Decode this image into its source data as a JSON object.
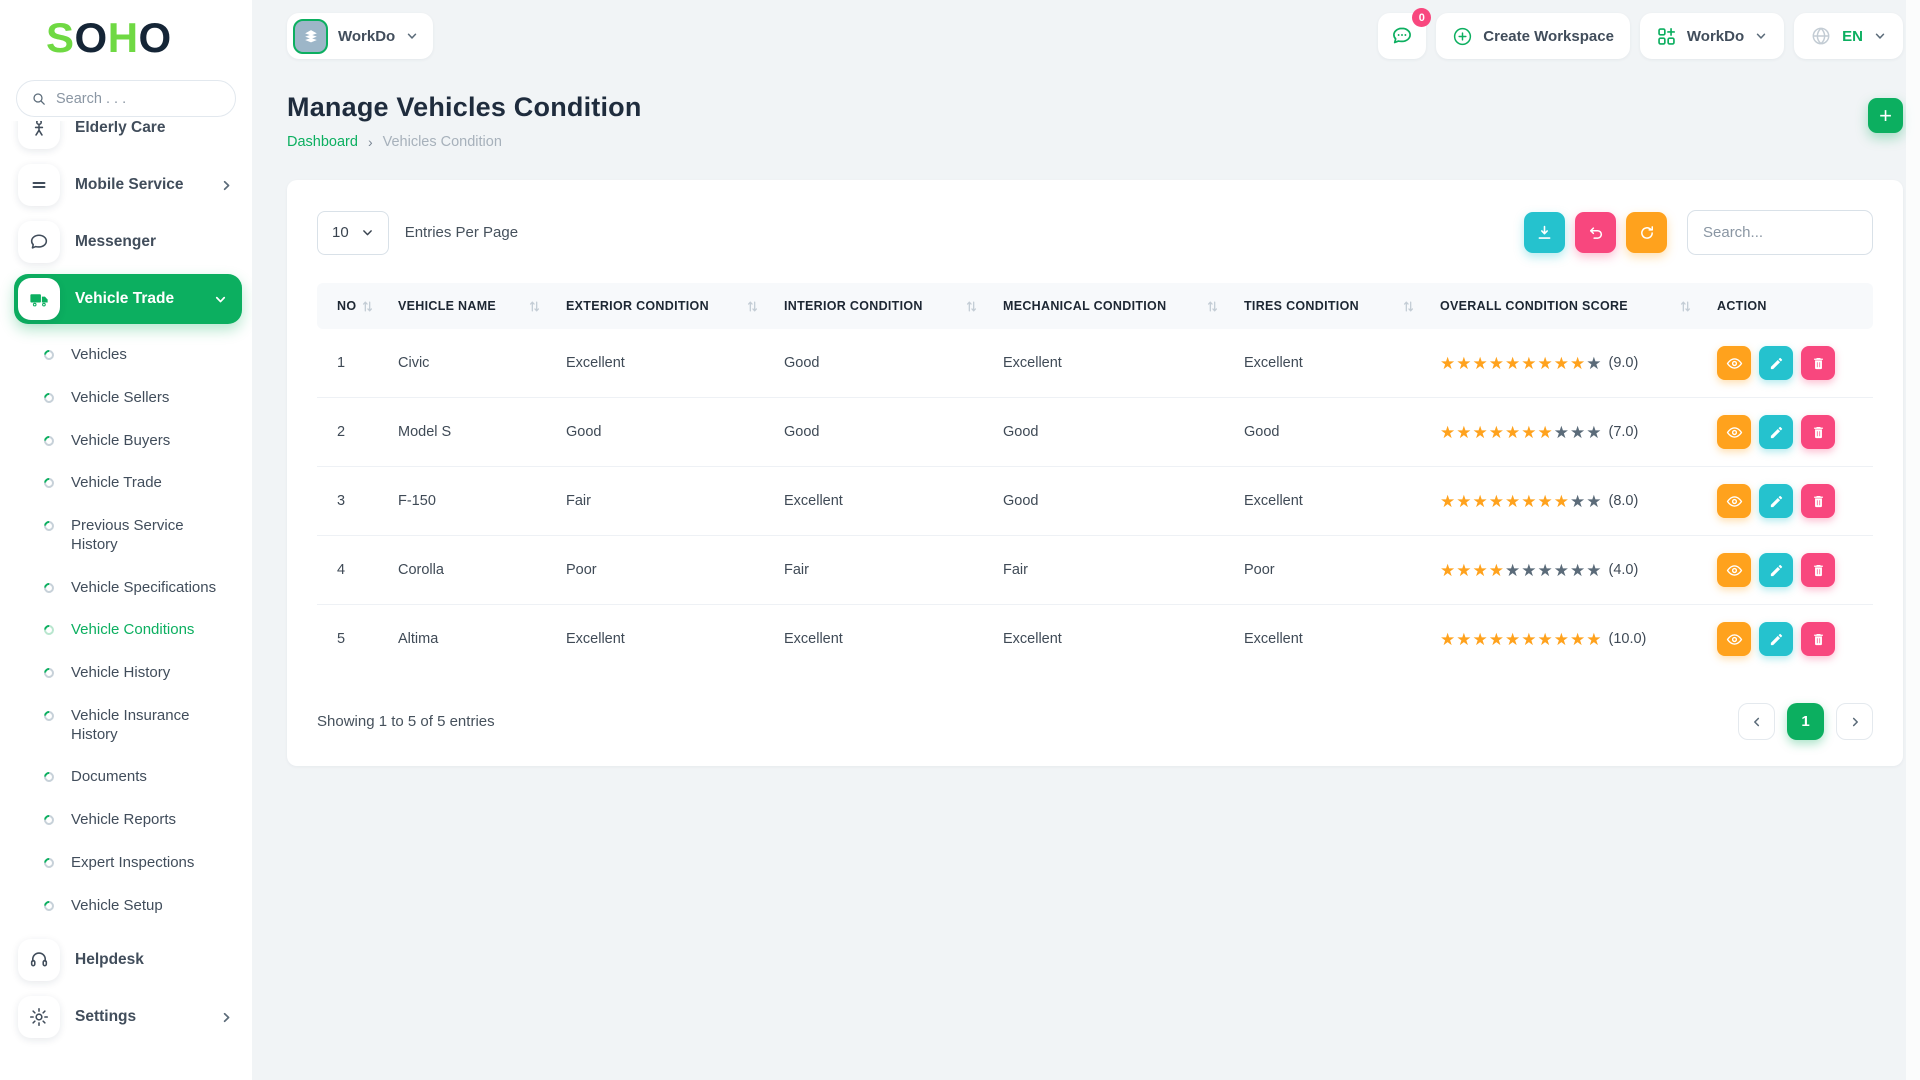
{
  "brand": {
    "letters": [
      {
        "ch": "S",
        "color": "#6fd943"
      },
      {
        "ch": "O",
        "color": "#152536"
      },
      {
        "ch": "H",
        "color": "#6fd943"
      },
      {
        "ch": "O",
        "color": "#152536"
      }
    ]
  },
  "sidebar": {
    "search_placeholder": "Search . . .",
    "items": [
      {
        "label": "Elderly Care"
      },
      {
        "label": "Mobile Service",
        "has_chevron": true
      },
      {
        "label": "Messenger"
      },
      {
        "label": "Vehicle Trade",
        "active": true,
        "expanded": true
      }
    ],
    "children": [
      {
        "label": "Vehicles",
        "active": false
      },
      {
        "label": "Vehicle Sellers",
        "active": false
      },
      {
        "label": "Vehicle Buyers",
        "active": false
      },
      {
        "label": "Vehicle Trade",
        "active": false
      },
      {
        "label": "Previous Service History",
        "active": false
      },
      {
        "label": "Vehicle Specifications",
        "active": false
      },
      {
        "label": "Vehicle Conditions",
        "active": true
      },
      {
        "label": "Vehicle History",
        "active": false
      },
      {
        "label": "Vehicle Insurance History",
        "active": false
      },
      {
        "label": "Documents",
        "active": false
      },
      {
        "label": "Vehicle Reports",
        "active": false
      },
      {
        "label": "Expert Inspections",
        "active": false
      },
      {
        "label": "Vehicle Setup",
        "active": false
      }
    ],
    "footer_items": [
      {
        "label": "Helpdesk"
      },
      {
        "label": "Settings",
        "has_chevron": true
      }
    ]
  },
  "header": {
    "workspace_name": "WorkDo",
    "messages_badge": "0",
    "create_workspace_label": "Create Workspace",
    "app_switcher_label": "WorkDo",
    "language": "EN"
  },
  "page": {
    "title": "Manage Vehicles Condition",
    "breadcrumb": {
      "root": "Dashboard",
      "separator": "›",
      "current": "Vehicles Condition"
    },
    "add_button": "+"
  },
  "toolbar": {
    "per_page_value": "10",
    "per_page_label": "Entries Per Page",
    "search_placeholder": "Search..."
  },
  "table": {
    "columns": [
      {
        "label": "NO",
        "sortable": true
      },
      {
        "label": "VEHICLE NAME",
        "sortable": true
      },
      {
        "label": "EXTERIOR CONDITION",
        "sortable": true
      },
      {
        "label": "INTERIOR CONDITION",
        "sortable": true
      },
      {
        "label": "MECHANICAL CONDITION",
        "sortable": true
      },
      {
        "label": "TIRES CONDITION",
        "sortable": true
      },
      {
        "label": "OVERALL CONDITION SCORE",
        "sortable": true
      },
      {
        "label": "ACTION",
        "sortable": false
      }
    ],
    "rows": [
      {
        "no": "1",
        "vehicle_name": "Civic",
        "exterior": "Excellent",
        "interior": "Good",
        "mechanical": "Excellent",
        "tires": "Excellent",
        "score": 9,
        "stars_total": 10,
        "score_label": "(9.0)"
      },
      {
        "no": "2",
        "vehicle_name": "Model S",
        "exterior": "Good",
        "interior": "Good",
        "mechanical": "Good",
        "tires": "Good",
        "score": 7,
        "stars_total": 10,
        "score_label": "(7.0)"
      },
      {
        "no": "3",
        "vehicle_name": "F-150",
        "exterior": "Fair",
        "interior": "Excellent",
        "mechanical": "Good",
        "tires": "Excellent",
        "score": 8,
        "stars_total": 10,
        "score_label": "(8.0)"
      },
      {
        "no": "4",
        "vehicle_name": "Corolla",
        "exterior": "Poor",
        "interior": "Fair",
        "mechanical": "Fair",
        "tires": "Poor",
        "score": 4,
        "stars_total": 10,
        "score_label": "(4.0)"
      },
      {
        "no": "5",
        "vehicle_name": "Altima",
        "exterior": "Excellent",
        "interior": "Excellent",
        "mechanical": "Excellent",
        "tires": "Excellent",
        "score": 10,
        "stars_total": 10,
        "score_label": "(10.0)"
      }
    ]
  },
  "footer": {
    "summary": "Showing 1 to 5 of 5 entries",
    "pagination": {
      "current": "1"
    }
  },
  "colors": {
    "primary_green": "#0CAF60",
    "logo_lime": "#6fd943",
    "star_filled": "#FFA21D",
    "star_empty": "#5B6B79",
    "info_cyan": "#25C2CE",
    "danger_pink": "#F8477E",
    "warning_orange": "#FFA21D"
  }
}
